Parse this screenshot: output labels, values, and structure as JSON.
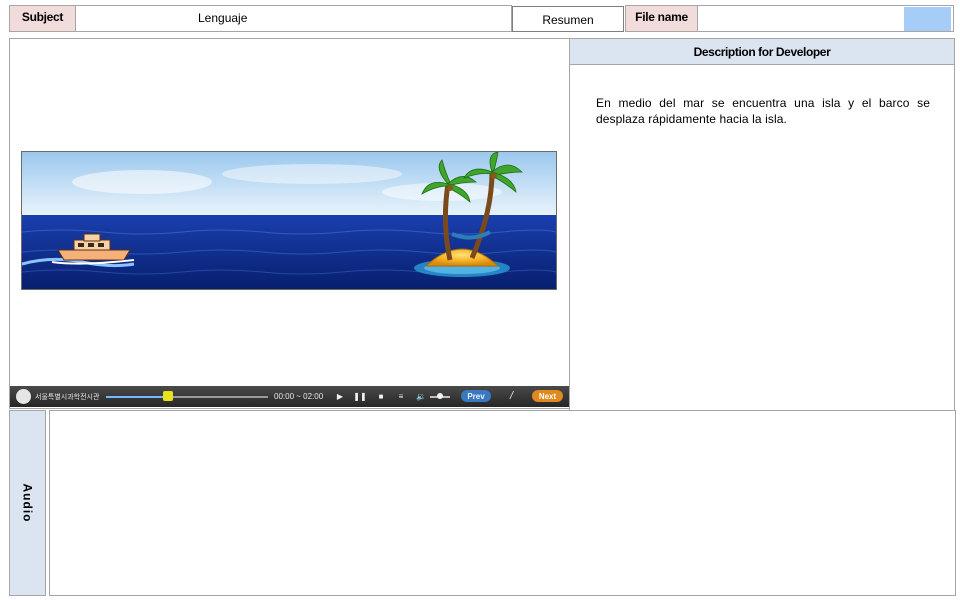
{
  "header": {
    "subject_label": "Subject",
    "subject_value": "Lenguaje",
    "summary_value": "Resumen",
    "filename_label": "File name",
    "filename_value": ""
  },
  "description": {
    "title": "Description for Developer",
    "text": "En medio del mar se encuentra una isla y el barco se desplaza rápidamente  hacia la isla."
  },
  "player": {
    "brand": "서울특별시과학전시관",
    "time": "00:00 ~ 02:00",
    "progress": 0.38,
    "volume": 0.5,
    "prev_label": "Prev",
    "separator": "/",
    "next_label": "Next",
    "icons": {
      "play": "play-icon",
      "pause": "pause-icon",
      "stop": "stop-icon",
      "menu": "menu-icon",
      "volume": "volume-icon"
    }
  },
  "audio": {
    "label": "Audio",
    "content": ""
  },
  "colors": {
    "label_pink": "#f2dcdb",
    "label_blue": "#dbe5f1",
    "swatch_blue": "#a5cdf7",
    "sea_dark": "#0b2a8a",
    "sky": "#cfe6f7",
    "next_orange": "#e0891f",
    "prev_blue": "#3a78c0"
  }
}
